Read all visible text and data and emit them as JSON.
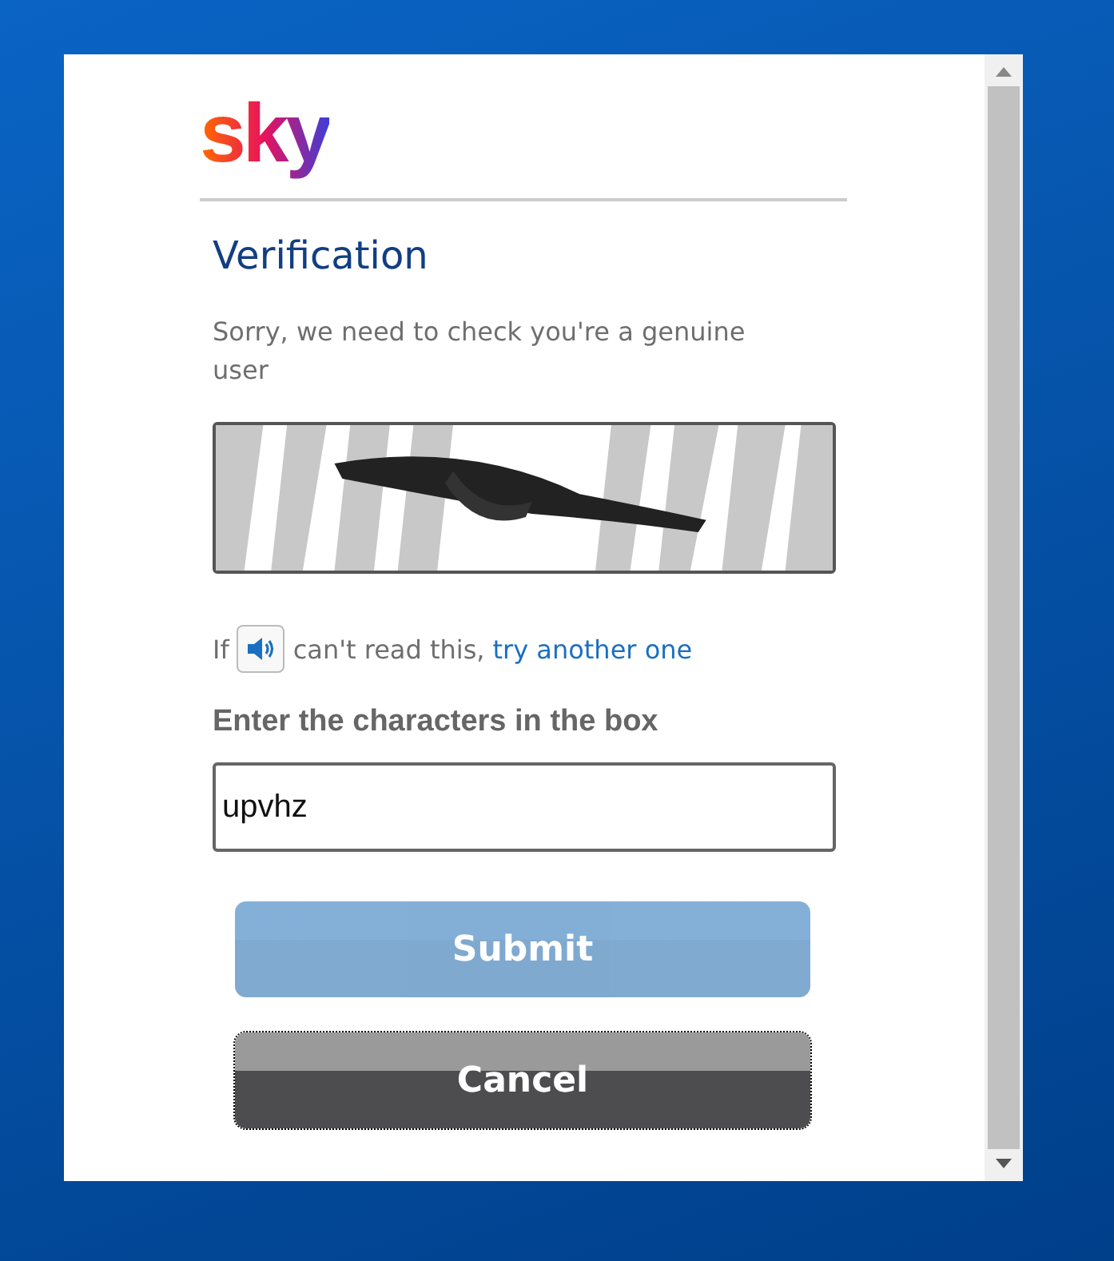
{
  "logo": "sky",
  "title": "Verification",
  "message": "Sorry, we need to check you're a genuine user",
  "hint": {
    "before": "If",
    "after": "can't read this,",
    "link": "try another one"
  },
  "field": {
    "label": "Enter the characters in the box",
    "value": "upvhz"
  },
  "buttons": [
    {
      "label": "Submit",
      "kind": "primary",
      "disabled": true,
      "focused": false
    },
    {
      "label": "Cancel",
      "kind": "secondary",
      "disabled": false,
      "focused": true
    }
  ]
}
